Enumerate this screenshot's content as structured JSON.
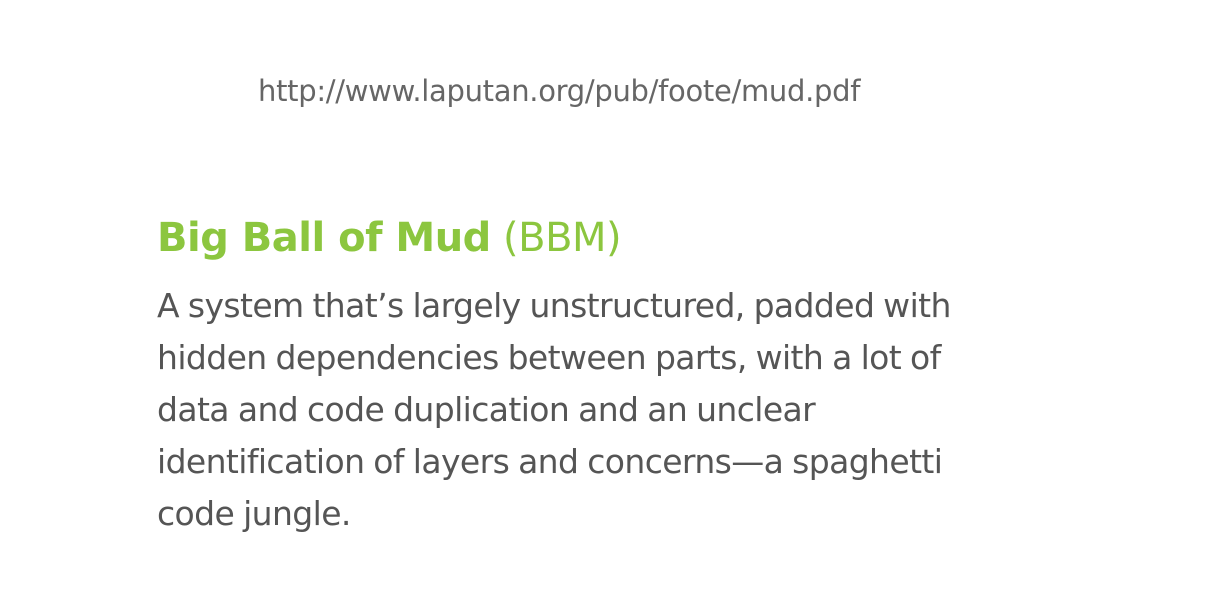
{
  "slide": {
    "url": "http://www.laputan.org/pub/foote/mud.pdf",
    "heading": {
      "term": "Big Ball of Mud",
      "abbreviation": "(BBM)"
    },
    "definition_lines": [
      "A system that’s largely unstructured, padded with",
      "hidden dependencies between parts, with a lot of",
      "data and code duplication and an unclear",
      "identification of layers and concerns—a spaghetti",
      "code jungle."
    ],
    "colors": {
      "accent": "#8cc63f",
      "body_text": "#555555",
      "url_text": "#666666",
      "background": "#ffffff"
    }
  }
}
